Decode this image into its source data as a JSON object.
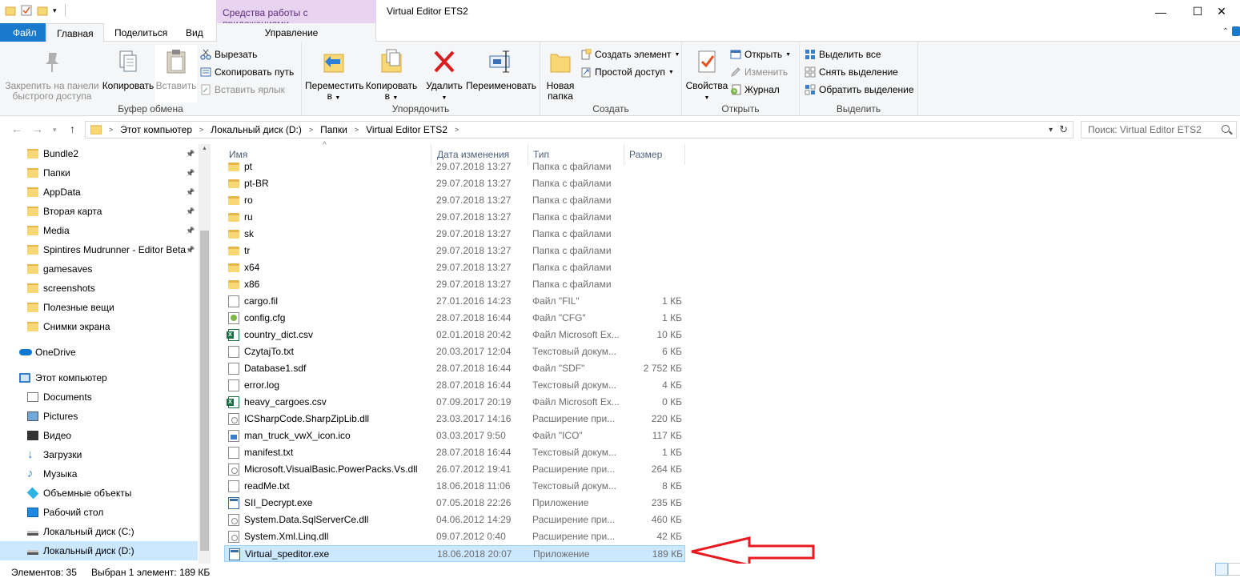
{
  "window": {
    "title": "Virtual Editor ETS2",
    "context_tab_title": "Средства работы с приложениями",
    "minimize": "—",
    "maximize": "☐",
    "close": "✕"
  },
  "tabs": {
    "file": "Файл",
    "home": "Главная",
    "share": "Поделиться",
    "view": "Вид",
    "manage": "Управление"
  },
  "ribbon": {
    "clipboard": {
      "label": "Буфер обмена",
      "pin": "Закрепить на панели быстрого доступа",
      "pin_line1": "Закрепить на панели",
      "pin_line2": "быстрого доступа",
      "copy": "Копировать",
      "paste": "Вставить",
      "cut": "Вырезать",
      "copy_path": "Скопировать путь",
      "paste_shortcut": "Вставить ярлык"
    },
    "organize": {
      "label": "Упорядочить",
      "move_line1": "Переместить",
      "move_line2": "в",
      "copy_line1": "Копировать",
      "copy_line2": "в",
      "delete": "Удалить",
      "rename": "Переименовать"
    },
    "create": {
      "label": "Создать",
      "new_folder_line1": "Новая",
      "new_folder_line2": "папка",
      "new_item": "Создать элемент",
      "easy_access": "Простой доступ"
    },
    "open": {
      "label": "Открыть",
      "properties": "Свойства",
      "open": "Открыть",
      "edit": "Изменить",
      "history": "Журнал"
    },
    "select": {
      "label": "Выделить",
      "select_all": "Выделить все",
      "select_none": "Снять выделение",
      "invert": "Обратить выделение"
    }
  },
  "address": {
    "crumbs": [
      "Этот компьютер",
      "Локальный диск (D:)",
      "Папки",
      "Virtual Editor ETS2"
    ],
    "search_placeholder": "Поиск: Virtual Editor ETS2"
  },
  "nav": {
    "quick": [
      {
        "label": "Bundle2",
        "pinned": true
      },
      {
        "label": "Папки",
        "pinned": true
      },
      {
        "label": "AppData",
        "pinned": true
      },
      {
        "label": "Вторая карта",
        "pinned": true
      },
      {
        "label": "Media",
        "pinned": true
      },
      {
        "label": "Spintires Mudrunner - Editor Beta",
        "pinned": true
      },
      {
        "label": "gamesaves",
        "pinned": false
      },
      {
        "label": "screenshots",
        "pinned": false
      },
      {
        "label": "Полезные вещи",
        "pinned": false
      },
      {
        "label": "Снимки экрана",
        "pinned": false
      }
    ],
    "onedrive": "OneDrive",
    "this_pc": "Этот компьютер",
    "pc_items": [
      {
        "label": "Documents",
        "icon": "documents-icon"
      },
      {
        "label": "Pictures",
        "icon": "pictures-icon"
      },
      {
        "label": "Видео",
        "icon": "video-icon"
      },
      {
        "label": "Загрузки",
        "icon": "downloads-icon"
      },
      {
        "label": "Музыка",
        "icon": "music-icon"
      },
      {
        "label": "Объемные объекты",
        "icon": "3d-objects-icon"
      },
      {
        "label": "Рабочий стол",
        "icon": "desktop-icon"
      },
      {
        "label": "Локальный диск (C:)",
        "icon": "drive-icon"
      },
      {
        "label": "Локальный диск (D:)",
        "icon": "drive-icon"
      }
    ]
  },
  "columns": {
    "name": "Имя",
    "date": "Дата изменения",
    "type": "Тип",
    "size": "Размер"
  },
  "files": [
    {
      "name": "pt",
      "date": "29.07.2018 13:27",
      "type": "Папка с файлами",
      "size": "",
      "kind": "folder"
    },
    {
      "name": "pt-BR",
      "date": "29.07.2018 13:27",
      "type": "Папка с файлами",
      "size": "",
      "kind": "folder"
    },
    {
      "name": "ro",
      "date": "29.07.2018 13:27",
      "type": "Папка с файлами",
      "size": "",
      "kind": "folder"
    },
    {
      "name": "ru",
      "date": "29.07.2018 13:27",
      "type": "Папка с файлами",
      "size": "",
      "kind": "folder"
    },
    {
      "name": "sk",
      "date": "29.07.2018 13:27",
      "type": "Папка с файлами",
      "size": "",
      "kind": "folder"
    },
    {
      "name": "tr",
      "date": "29.07.2018 13:27",
      "type": "Папка с файлами",
      "size": "",
      "kind": "folder"
    },
    {
      "name": "x64",
      "date": "29.07.2018 13:27",
      "type": "Папка с файлами",
      "size": "",
      "kind": "folder"
    },
    {
      "name": "x86",
      "date": "29.07.2018 13:27",
      "type": "Папка с файлами",
      "size": "",
      "kind": "folder"
    },
    {
      "name": "cargo.fil",
      "date": "27.01.2016 14:23",
      "type": "Файл \"FIL\"",
      "size": "1 КБ",
      "kind": "doc"
    },
    {
      "name": "config.cfg",
      "date": "28.07.2018 16:44",
      "type": "Файл \"CFG\"",
      "size": "1 КБ",
      "kind": "cfg"
    },
    {
      "name": "country_dict.csv",
      "date": "02.01.2018 20:42",
      "type": "Файл Microsoft Ex...",
      "size": "10 КБ",
      "kind": "excel"
    },
    {
      "name": "CzytajTo.txt",
      "date": "20.03.2017 12:04",
      "type": "Текстовый докум...",
      "size": "6 КБ",
      "kind": "doc"
    },
    {
      "name": "Database1.sdf",
      "date": "28.07.2018 16:44",
      "type": "Файл \"SDF\"",
      "size": "2 752 КБ",
      "kind": "doc"
    },
    {
      "name": "error.log",
      "date": "28.07.2018 16:44",
      "type": "Текстовый докум...",
      "size": "4 КБ",
      "kind": "doc"
    },
    {
      "name": "heavy_cargoes.csv",
      "date": "07.09.2017 20:19",
      "type": "Файл Microsoft Ex...",
      "size": "0 КБ",
      "kind": "excel"
    },
    {
      "name": "ICSharpCode.SharpZipLib.dll",
      "date": "23.03.2017 14:16",
      "type": "Расширение при...",
      "size": "220 КБ",
      "kind": "dll"
    },
    {
      "name": "man_truck_vwX_icon.ico",
      "date": "03.03.2017 9:50",
      "type": "Файл \"ICO\"",
      "size": "117 КБ",
      "kind": "ico-file"
    },
    {
      "name": "manifest.txt",
      "date": "28.07.2018 16:44",
      "type": "Текстовый докум...",
      "size": "1 КБ",
      "kind": "doc"
    },
    {
      "name": "Microsoft.VisualBasic.PowerPacks.Vs.dll",
      "date": "26.07.2012 19:41",
      "type": "Расширение при...",
      "size": "264 КБ",
      "kind": "dll"
    },
    {
      "name": "readMe.txt",
      "date": "18.06.2018 11:06",
      "type": "Текстовый докум...",
      "size": "8 КБ",
      "kind": "doc"
    },
    {
      "name": "SII_Decrypt.exe",
      "date": "07.05.2018 22:26",
      "type": "Приложение",
      "size": "235 КБ",
      "kind": "exe"
    },
    {
      "name": "System.Data.SqlServerCe.dll",
      "date": "04.06.2012 14:29",
      "type": "Расширение при...",
      "size": "460 КБ",
      "kind": "dll"
    },
    {
      "name": "System.Xml.Linq.dll",
      "date": "09.07.2012 0:40",
      "type": "Расширение при...",
      "size": "42 КБ",
      "kind": "dll"
    },
    {
      "name": "Virtual_speditor.exe",
      "date": "18.06.2018 20:07",
      "type": "Приложение",
      "size": "189 КБ",
      "kind": "exe",
      "selected": true
    }
  ],
  "status": {
    "count": "Элементов: 35",
    "selected": "Выбран 1 элемент: 189 КБ"
  },
  "colors": {
    "accent": "#1979ca",
    "selection": "#cce8ff",
    "context_tab": "#e8d3f1",
    "annotation_arrow": "#e8191f"
  }
}
